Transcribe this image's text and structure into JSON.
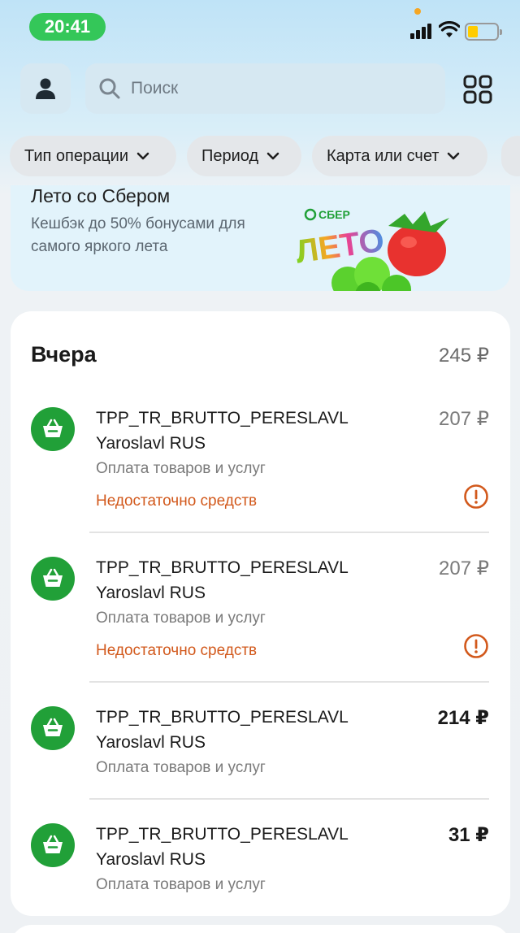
{
  "status_bar": {
    "time": "20:41"
  },
  "search": {
    "placeholder": "Поиск"
  },
  "filters": [
    {
      "label": "Тип операции"
    },
    {
      "label": "Период"
    },
    {
      "label": "Карта или счет"
    }
  ],
  "promo": {
    "title": "Лето со Сбером",
    "subtitle": "Кешбэк до 50% бонусами для самого яркого лета",
    "logo_small": "СБЕР",
    "logo_big": "ЛЕТО"
  },
  "day_group": {
    "title": "Вчера",
    "total": "245 ₽",
    "transactions": [
      {
        "name_line1": "TPP_TR_BRUTTO_PERESLAVL",
        "name_line2": "Yaroslavl RUS",
        "category": "Оплата товаров и услуг",
        "status": "Недостаточно средств",
        "amount": "207 ₽"
      },
      {
        "name_line1": "TPP_TR_BRUTTO_PERESLAVL",
        "name_line2": "Yaroslavl RUS",
        "category": "Оплата товаров и услуг",
        "status": "Недостаточно средств",
        "amount": "207 ₽"
      },
      {
        "name_line1": "TPP_TR_BRUTTO_PERESLAVL",
        "name_line2": "Yaroslavl RUS",
        "category": "Оплата товаров и услуг",
        "amount": "214 ₽"
      },
      {
        "name_line1": "TPP_TR_BRUTTO_PERESLAVL",
        "name_line2": "Yaroslavl RUS",
        "category": "Оплата товаров и услуг",
        "amount": "31 ₽"
      }
    ]
  },
  "colors": {
    "brand_green": "#21a038",
    "status_pill": "#34c759",
    "error_orange": "#d2591c"
  },
  "icons": {
    "profile": "person-icon",
    "search": "search-icon",
    "menu": "grid-icon",
    "transaction": "basket-icon",
    "warning": "exclamation-circle-icon"
  }
}
